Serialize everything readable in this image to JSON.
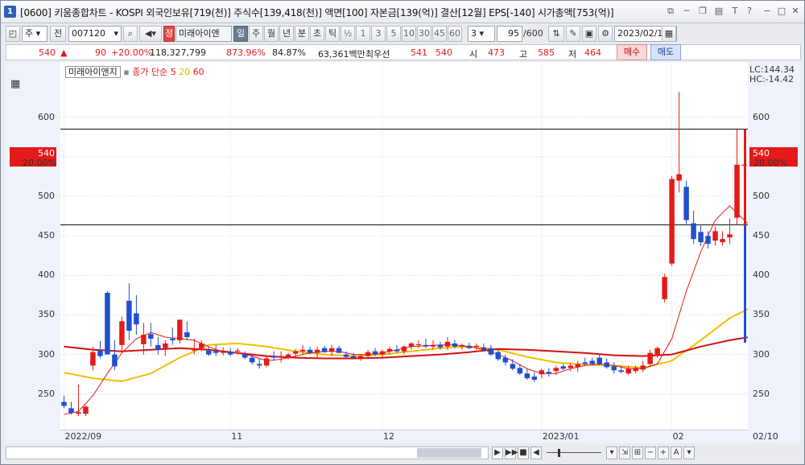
{
  "window": {
    "number": "1",
    "title": "[0600] 키움종합차트 - KOSPI 외국인보유[719(천)] 주식수[139,418(천)] 액면[100] 자본금[139(억)] 결산[12월] EPS[-140] 시가총액[753(억)]"
  },
  "toolbar": {
    "period_select": "주",
    "tab_all": "전",
    "code": "007120",
    "name": "미래아이앤",
    "name_badge": "정",
    "periods": [
      "일",
      "주",
      "월",
      "년",
      "분",
      "초",
      "틱"
    ],
    "active_period": "일",
    "intervals": [
      "½",
      "1",
      "3",
      "5",
      "10",
      "30",
      "45",
      "60"
    ],
    "interval_select": "3",
    "count": "95",
    "count_total": "/600",
    "date": "2023/02/10"
  },
  "quote": {
    "price": "540",
    "change": "90",
    "change_pct": "+20.00%",
    "volume": "118,327,799",
    "volume_ratio": "873.96%",
    "turnover": "84.87%",
    "amount": "63,361백만",
    "best_bid_label": "최우선",
    "bid": "541",
    "ask": "540",
    "open_label": "시",
    "open": "473",
    "high_label": "고",
    "high": "585",
    "low_label": "저",
    "low": "464",
    "buy_label": "매수",
    "sell_label": "매도"
  },
  "legend": {
    "name": "미래아이앤지",
    "series_label": "종가 단순",
    "ma": [
      "5",
      "20",
      "60"
    ]
  },
  "indicators": {
    "lc": "LC:144.34",
    "hc": "HC:-14.42",
    "current_price": "540",
    "current_pct": "20.00%"
  },
  "chart_data": {
    "type": "candlestick",
    "title": "미래아이앤지",
    "y_ticks": [
      250,
      300,
      350,
      400,
      450,
      500,
      550,
      600
    ],
    "ylim": [
      205,
      670
    ],
    "x_ticks": [
      "2022/09",
      "11",
      "12",
      "2023/01",
      "02",
      "02/10"
    ],
    "hlines": [
      585,
      464
    ],
    "colors": {
      "up": "#e41a1a",
      "down": "#1f4fd1",
      "ma5": "#e41a1a",
      "ma20": "#f0c000",
      "ma60": "#d41010"
    },
    "candles": [
      {
        "o": 240,
        "h": 248,
        "l": 232,
        "c": 235
      },
      {
        "o": 232,
        "h": 240,
        "l": 224,
        "c": 226
      },
      {
        "o": 225,
        "h": 262,
        "l": 222,
        "c": 227
      },
      {
        "o": 225,
        "h": 236,
        "l": 222,
        "c": 234
      },
      {
        "o": 286,
        "h": 310,
        "l": 280,
        "c": 303
      },
      {
        "o": 305,
        "h": 317,
        "l": 295,
        "c": 298
      },
      {
        "o": 378,
        "h": 380,
        "l": 300,
        "c": 300
      },
      {
        "o": 300,
        "h": 318,
        "l": 280,
        "c": 285
      },
      {
        "o": 312,
        "h": 348,
        "l": 305,
        "c": 342
      },
      {
        "o": 368,
        "h": 390,
        "l": 318,
        "c": 330
      },
      {
        "o": 352,
        "h": 375,
        "l": 325,
        "c": 338
      },
      {
        "o": 313,
        "h": 340,
        "l": 300,
        "c": 325
      },
      {
        "o": 326,
        "h": 340,
        "l": 310,
        "c": 320
      },
      {
        "o": 312,
        "h": 322,
        "l": 300,
        "c": 306
      },
      {
        "o": 308,
        "h": 318,
        "l": 298,
        "c": 314
      },
      {
        "o": 320,
        "h": 334,
        "l": 312,
        "c": 318
      },
      {
        "o": 318,
        "h": 344,
        "l": 314,
        "c": 344
      },
      {
        "o": 328,
        "h": 342,
        "l": 318,
        "c": 322
      },
      {
        "o": 305,
        "h": 320,
        "l": 300,
        "c": 307
      },
      {
        "o": 308,
        "h": 318,
        "l": 304,
        "c": 314
      },
      {
        "o": 305,
        "h": 310,
        "l": 298,
        "c": 300
      },
      {
        "o": 304,
        "h": 312,
        "l": 298,
        "c": 302
      },
      {
        "o": 302,
        "h": 309,
        "l": 299,
        "c": 304
      },
      {
        "o": 303,
        "h": 308,
        "l": 298,
        "c": 300
      },
      {
        "o": 304,
        "h": 308,
        "l": 300,
        "c": 305
      },
      {
        "o": 300,
        "h": 304,
        "l": 294,
        "c": 296
      },
      {
        "o": 296,
        "h": 300,
        "l": 287,
        "c": 290
      },
      {
        "o": 288,
        "h": 295,
        "l": 282,
        "c": 286
      },
      {
        "o": 286,
        "h": 298,
        "l": 284,
        "c": 295
      },
      {
        "o": 298,
        "h": 304,
        "l": 292,
        "c": 296
      },
      {
        "o": 296,
        "h": 304,
        "l": 290,
        "c": 298
      },
      {
        "o": 297,
        "h": 302,
        "l": 294,
        "c": 300
      },
      {
        "o": 301,
        "h": 307,
        "l": 296,
        "c": 304
      },
      {
        "o": 304,
        "h": 312,
        "l": 300,
        "c": 306
      },
      {
        "o": 306,
        "h": 310,
        "l": 300,
        "c": 302
      },
      {
        "o": 302,
        "h": 310,
        "l": 296,
        "c": 306
      },
      {
        "o": 308,
        "h": 311,
        "l": 302,
        "c": 303
      },
      {
        "o": 304,
        "h": 312,
        "l": 298,
        "c": 308
      },
      {
        "o": 308,
        "h": 311,
        "l": 302,
        "c": 302
      },
      {
        "o": 300,
        "h": 304,
        "l": 296,
        "c": 297
      },
      {
        "o": 298,
        "h": 302,
        "l": 294,
        "c": 296
      },
      {
        "o": 296,
        "h": 300,
        "l": 292,
        "c": 298
      },
      {
        "o": 298,
        "h": 306,
        "l": 294,
        "c": 303
      },
      {
        "o": 304,
        "h": 308,
        "l": 298,
        "c": 300
      },
      {
        "o": 300,
        "h": 306,
        "l": 296,
        "c": 304
      },
      {
        "o": 304,
        "h": 310,
        "l": 300,
        "c": 307
      },
      {
        "o": 306,
        "h": 312,
        "l": 302,
        "c": 304
      },
      {
        "o": 304,
        "h": 312,
        "l": 300,
        "c": 310
      },
      {
        "o": 310,
        "h": 316,
        "l": 306,
        "c": 314
      },
      {
        "o": 312,
        "h": 318,
        "l": 308,
        "c": 313
      },
      {
        "o": 312,
        "h": 320,
        "l": 308,
        "c": 310
      },
      {
        "o": 310,
        "h": 318,
        "l": 306,
        "c": 312
      },
      {
        "o": 312,
        "h": 316,
        "l": 306,
        "c": 309
      },
      {
        "o": 310,
        "h": 322,
        "l": 306,
        "c": 316
      },
      {
        "o": 314,
        "h": 318,
        "l": 308,
        "c": 310
      },
      {
        "o": 310,
        "h": 314,
        "l": 306,
        "c": 312
      },
      {
        "o": 311,
        "h": 315,
        "l": 307,
        "c": 308
      },
      {
        "o": 310,
        "h": 314,
        "l": 306,
        "c": 311
      },
      {
        "o": 309,
        "h": 314,
        "l": 304,
        "c": 306
      },
      {
        "o": 308,
        "h": 312,
        "l": 298,
        "c": 300
      },
      {
        "o": 303,
        "h": 307,
        "l": 292,
        "c": 294
      },
      {
        "o": 296,
        "h": 300,
        "l": 286,
        "c": 290
      },
      {
        "o": 288,
        "h": 294,
        "l": 280,
        "c": 282
      },
      {
        "o": 283,
        "h": 288,
        "l": 274,
        "c": 276
      },
      {
        "o": 276,
        "h": 282,
        "l": 268,
        "c": 270
      },
      {
        "o": 272,
        "h": 278,
        "l": 265,
        "c": 268
      },
      {
        "o": 275,
        "h": 282,
        "l": 270,
        "c": 280
      },
      {
        "o": 278,
        "h": 283,
        "l": 272,
        "c": 276
      },
      {
        "o": 279,
        "h": 286,
        "l": 274,
        "c": 283
      },
      {
        "o": 285,
        "h": 288,
        "l": 280,
        "c": 282
      },
      {
        "o": 283,
        "h": 289,
        "l": 279,
        "c": 286
      },
      {
        "o": 284,
        "h": 292,
        "l": 278,
        "c": 288
      },
      {
        "o": 290,
        "h": 296,
        "l": 286,
        "c": 288
      },
      {
        "o": 292,
        "h": 296,
        "l": 286,
        "c": 288
      },
      {
        "o": 296,
        "h": 300,
        "l": 286,
        "c": 288
      },
      {
        "o": 290,
        "h": 295,
        "l": 282,
        "c": 284
      },
      {
        "o": 285,
        "h": 290,
        "l": 276,
        "c": 280
      },
      {
        "o": 280,
        "h": 286,
        "l": 276,
        "c": 278
      },
      {
        "o": 276,
        "h": 286,
        "l": 274,
        "c": 282
      },
      {
        "o": 279,
        "h": 286,
        "l": 276,
        "c": 283
      },
      {
        "o": 281,
        "h": 292,
        "l": 278,
        "c": 286
      },
      {
        "o": 288,
        "h": 306,
        "l": 284,
        "c": 302
      },
      {
        "o": 300,
        "h": 310,
        "l": 296,
        "c": 308
      },
      {
        "o": 370,
        "h": 402,
        "l": 366,
        "c": 398
      },
      {
        "o": 415,
        "h": 526,
        "l": 412,
        "c": 522
      },
      {
        "o": 520,
        "h": 632,
        "l": 505,
        "c": 528
      },
      {
        "o": 512,
        "h": 520,
        "l": 465,
        "c": 470
      },
      {
        "o": 466,
        "h": 482,
        "l": 440,
        "c": 446
      },
      {
        "o": 455,
        "h": 463,
        "l": 437,
        "c": 442
      },
      {
        "o": 450,
        "h": 456,
        "l": 434,
        "c": 440
      },
      {
        "o": 444,
        "h": 462,
        "l": 438,
        "c": 456
      },
      {
        "o": 442,
        "h": 456,
        "l": 438,
        "c": 446
      },
      {
        "o": 448,
        "h": 472,
        "l": 440,
        "c": 452
      },
      {
        "o": 473,
        "h": 585,
        "l": 464,
        "c": 540
      },
      {
        "o": 540,
        "h": 585,
        "l": 464,
        "c": 540
      }
    ],
    "ma5": [
      [
        0,
        224
      ],
      [
        2,
        228
      ],
      [
        4,
        248
      ],
      [
        6,
        276
      ],
      [
        8,
        302
      ],
      [
        10,
        320
      ],
      [
        12,
        328
      ],
      [
        14,
        322
      ],
      [
        16,
        320
      ],
      [
        18,
        318
      ],
      [
        20,
        310
      ],
      [
        22,
        303
      ],
      [
        24,
        302
      ],
      [
        26,
        298
      ],
      [
        28,
        292
      ],
      [
        30,
        294
      ],
      [
        32,
        298
      ],
      [
        34,
        302
      ],
      [
        36,
        304
      ],
      [
        38,
        304
      ],
      [
        40,
        300
      ],
      [
        42,
        300
      ],
      [
        44,
        302
      ],
      [
        46,
        306
      ],
      [
        48,
        310
      ],
      [
        50,
        311
      ],
      [
        52,
        312
      ],
      [
        54,
        312
      ],
      [
        56,
        310
      ],
      [
        58,
        306
      ],
      [
        60,
        300
      ],
      [
        62,
        292
      ],
      [
        64,
        282
      ],
      [
        66,
        276
      ],
      [
        68,
        276
      ],
      [
        70,
        282
      ],
      [
        72,
        286
      ],
      [
        74,
        288
      ],
      [
        76,
        286
      ],
      [
        78,
        282
      ],
      [
        80,
        282
      ],
      [
        82,
        288
      ],
      [
        84,
        320
      ],
      [
        86,
        380
      ],
      [
        88,
        430
      ],
      [
        90,
        470
      ],
      [
        92,
        488
      ],
      [
        94,
        470
      ],
      [
        96,
        454
      ],
      [
        98,
        462
      ]
    ],
    "ma20": [
      [
        0,
        277
      ],
      [
        4,
        270
      ],
      [
        8,
        266
      ],
      [
        12,
        276
      ],
      [
        16,
        296
      ],
      [
        20,
        312
      ],
      [
        24,
        314
      ],
      [
        28,
        310
      ],
      [
        32,
        304
      ],
      [
        36,
        300
      ],
      [
        40,
        298
      ],
      [
        44,
        300
      ],
      [
        48,
        304
      ],
      [
        52,
        308
      ],
      [
        56,
        310
      ],
      [
        60,
        306
      ],
      [
        64,
        297
      ],
      [
        68,
        290
      ],
      [
        72,
        287
      ],
      [
        76,
        286
      ],
      [
        80,
        283
      ],
      [
        84,
        292
      ],
      [
        88,
        318
      ],
      [
        92,
        346
      ],
      [
        96,
        364
      ],
      [
        98,
        381
      ]
    ],
    "ma60": [
      [
        0,
        310
      ],
      [
        4,
        306
      ],
      [
        8,
        304
      ],
      [
        12,
        306
      ],
      [
        16,
        308
      ],
      [
        20,
        306
      ],
      [
        24,
        302
      ],
      [
        28,
        298
      ],
      [
        32,
        296
      ],
      [
        36,
        295
      ],
      [
        40,
        295
      ],
      [
        44,
        296
      ],
      [
        48,
        298
      ],
      [
        52,
        300
      ],
      [
        56,
        303
      ],
      [
        60,
        307
      ],
      [
        64,
        306
      ],
      [
        68,
        304
      ],
      [
        72,
        302
      ],
      [
        76,
        299
      ],
      [
        80,
        298
      ],
      [
        84,
        300
      ],
      [
        88,
        310
      ],
      [
        92,
        318
      ],
      [
        96,
        324
      ],
      [
        98,
        327
      ]
    ]
  },
  "scroll": {
    "prev": "◀",
    "next": "▶",
    "play": "▶▶",
    "stop": "■",
    "zoom_minus": "−",
    "zoom_plus": "+",
    "font_a": "A",
    "dropdown": "▾"
  }
}
